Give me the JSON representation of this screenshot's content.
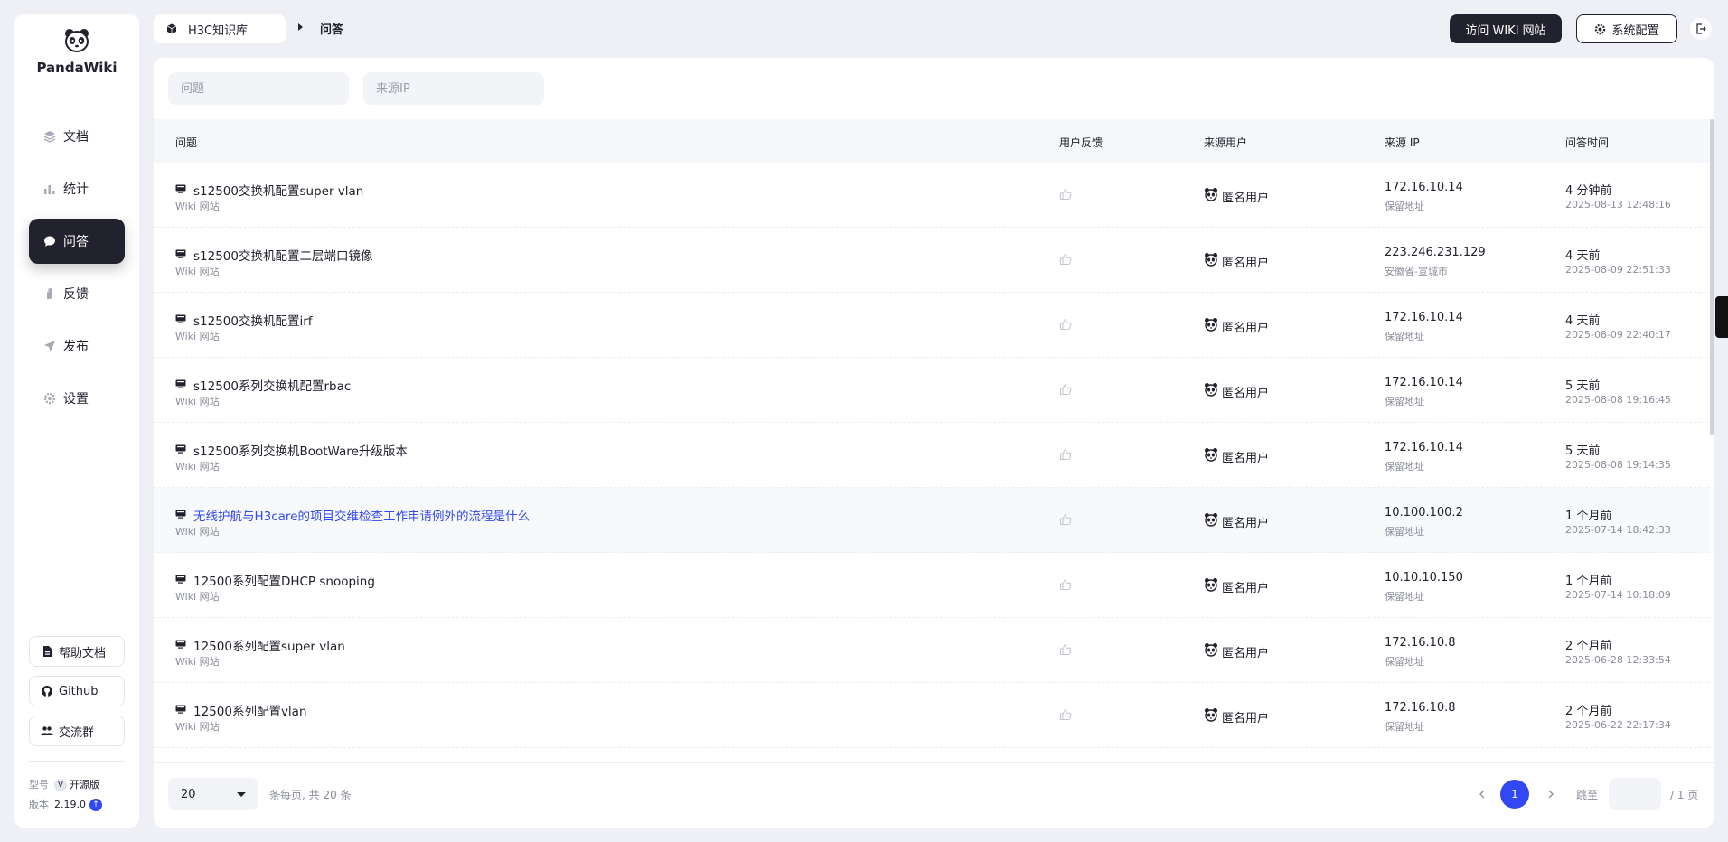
{
  "app": {
    "name": "PandaWiki"
  },
  "nav": [
    {
      "label": "文档",
      "icon": "layers-icon"
    },
    {
      "label": "统计",
      "icon": "bar-chart-icon"
    },
    {
      "label": "问答",
      "icon": "chat-bubble-icon",
      "active": true
    },
    {
      "label": "反馈",
      "icon": "hand-icon"
    },
    {
      "label": "发布",
      "icon": "send-icon"
    },
    {
      "label": "设置",
      "icon": "gear-icon"
    }
  ],
  "side_buttons": {
    "help": "帮助文档",
    "github": "Github",
    "group": "交流群"
  },
  "meta": {
    "model_label": "型号",
    "model_value": "开源版",
    "version_label": "版本",
    "version_value": "2.19.0"
  },
  "header": {
    "kb_name": "H3C知识库",
    "current": "问答",
    "visit_wiki": "访问 WIKI 网站",
    "system_config": "系统配置"
  },
  "filters": {
    "question_placeholder": "问题",
    "ip_placeholder": "来源IP"
  },
  "table": {
    "columns": {
      "question": "问题",
      "feedback": "用户反馈",
      "user": "来源用户",
      "ip": "来源 IP",
      "time": "问答时间"
    },
    "rows": [
      {
        "title": "s12500交换机配置super vlan",
        "source": "Wiki 网站",
        "user": "匿名用户",
        "ip": "172.16.10.14",
        "location": "保留地址",
        "relative": "4 分钟前",
        "time": "2025-08-13 12:48:16"
      },
      {
        "title": "s12500交换机配置二层端口镜像",
        "source": "Wiki 网站",
        "user": "匿名用户",
        "ip": "223.246.231.129",
        "location": "安徽省-宣城市",
        "relative": "4 天前",
        "time": "2025-08-09 22:51:33"
      },
      {
        "title": "s12500交换机配置irf",
        "source": "Wiki 网站",
        "user": "匿名用户",
        "ip": "172.16.10.14",
        "location": "保留地址",
        "relative": "4 天前",
        "time": "2025-08-09 22:40:17"
      },
      {
        "title": "s12500系列交换机配置rbac",
        "source": "Wiki 网站",
        "user": "匿名用户",
        "ip": "172.16.10.14",
        "location": "保留地址",
        "relative": "5 天前",
        "time": "2025-08-08 19:16:45"
      },
      {
        "title": "s12500系列交换机BootWare升级版本",
        "source": "Wiki 网站",
        "user": "匿名用户",
        "ip": "172.16.10.14",
        "location": "保留地址",
        "relative": "5 天前",
        "time": "2025-08-08 19:14:35"
      },
      {
        "title": "无线护航与H3care的项目交维检查工作申请例外的流程是什么",
        "source": "Wiki 网站",
        "user": "匿名用户",
        "ip": "10.100.100.2",
        "location": "保留地址",
        "relative": "1 个月前",
        "time": "2025-07-14 18:42:33",
        "highlight": true
      },
      {
        "title": "12500系列配置DHCP snooping",
        "source": "Wiki 网站",
        "user": "匿名用户",
        "ip": "10.10.10.150",
        "location": "保留地址",
        "relative": "1 个月前",
        "time": "2025-07-14 10:18:09"
      },
      {
        "title": "12500系列配置super vlan",
        "source": "Wiki 网站",
        "user": "匿名用户",
        "ip": "172.16.10.8",
        "location": "保留地址",
        "relative": "2 个月前",
        "time": "2025-06-28 12:33:54"
      },
      {
        "title": "12500系列配置vlan",
        "source": "Wiki 网站",
        "user": "匿名用户",
        "ip": "172.16.10.8",
        "location": "保留地址",
        "relative": "2 个月前",
        "time": "2025-06-22 22:17:34"
      }
    ]
  },
  "pagination": {
    "page_size": "20",
    "total_text": "条每页, 共 20 条",
    "current_page": "1",
    "jump_label": "跳至",
    "pages_total": "/ 1 页"
  }
}
